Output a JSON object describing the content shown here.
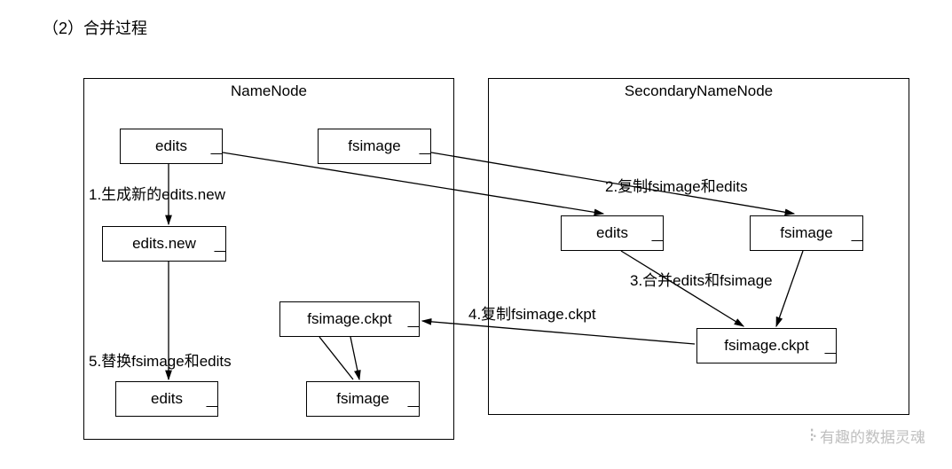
{
  "title": "（2）合并过程",
  "namenode": {
    "title": "NameNode",
    "boxes": {
      "edits": "edits",
      "fsimage": "fsimage",
      "edits_new": "edits.new",
      "fsimage_ckpt": "fsimage.ckpt",
      "edits_final": "edits",
      "fsimage_final": "fsimage"
    }
  },
  "secondary": {
    "title": "SecondaryNameNode",
    "boxes": {
      "edits": "edits",
      "fsimage": "fsimage",
      "fsimage_ckpt": "fsimage.ckpt"
    }
  },
  "steps": {
    "s1": "1.生成新的edits.new",
    "s2": "2.复制fsimage和edits",
    "s3": "3.合并edits和fsimage",
    "s4": "4.复制fsimage.ckpt",
    "s5": "5.替换fsimage和edits"
  },
  "watermark": "有趣的数据灵魂"
}
